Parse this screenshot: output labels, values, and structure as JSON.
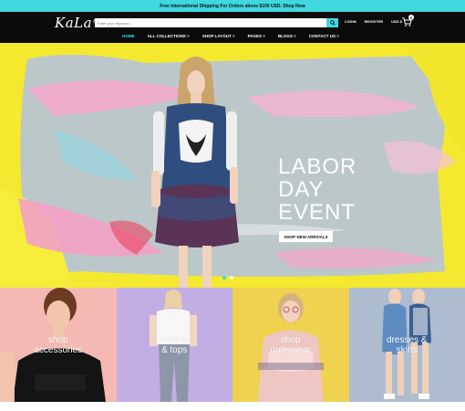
{
  "topbar": {
    "text": "Free International Shipping For Orders above $100 USD. Shop Now"
  },
  "header": {
    "logo": "KaLa",
    "logo_mark": "ع",
    "search_placeholder": "Enter your keyword...",
    "login": "LOGIN",
    "register": "REGISTER",
    "currency": "USD $",
    "cart_count": "0"
  },
  "nav": {
    "items": [
      "HOME",
      "ALL COLLECTIONS ˅",
      "SHOP LAYOUT ˅",
      "PAGES ˅",
      "BLOGS ˅",
      "CONTACT US ˅"
    ]
  },
  "hero": {
    "title_line1": "LABOR",
    "title_line2": "DAY",
    "title_line3": "EVENT",
    "button": "SHOP NEW ARRIVALS",
    "active_slide": 1,
    "slide_count": 2
  },
  "categories": [
    {
      "line1": "shop",
      "line2": "accessories",
      "bg": "#f4b9b3"
    },
    {
      "line1": "t-shirts",
      "line2": "& tops",
      "bg": "#c3aee4"
    },
    {
      "line1": "shop",
      "line2": "outerwear",
      "bg": "#efd24f"
    },
    {
      "line1": "dresses &",
      "line2": "skirts",
      "bg": "#aebcd0"
    }
  ],
  "colors": {
    "accent": "#3fd8e0",
    "header_bg": "#0b0b0b",
    "hero_yellow": "#f2e62c",
    "hero_pink": "#f2a9cb"
  }
}
